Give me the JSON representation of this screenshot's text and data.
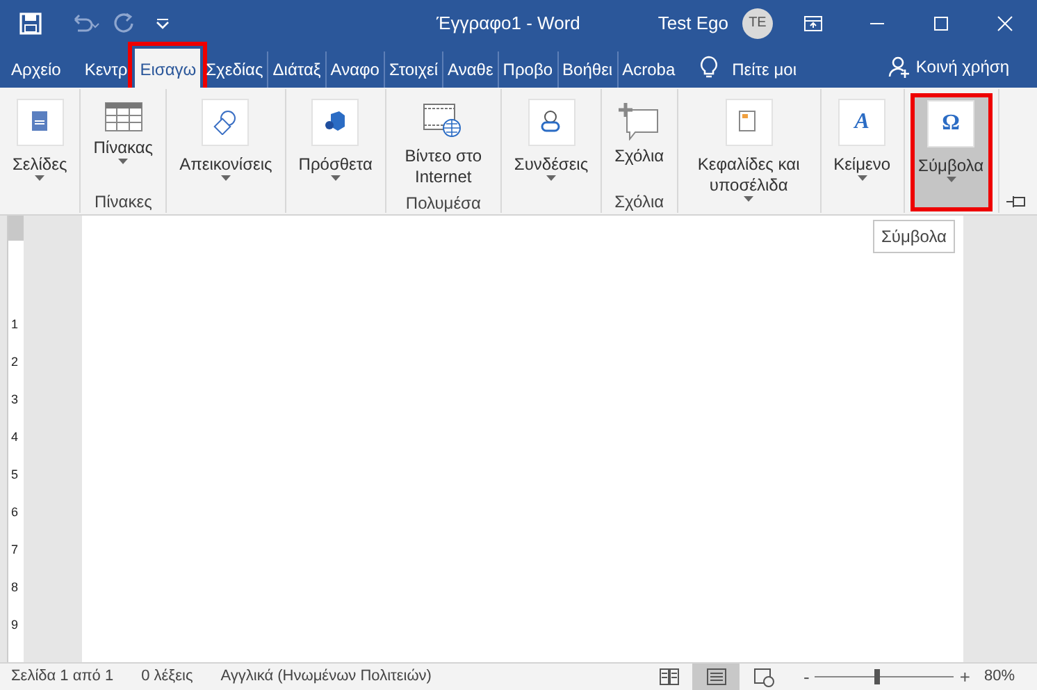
{
  "title_bar": {
    "title": "Έγγραφο1 - Word",
    "user": "Test Ego",
    "avatar_initials": "TE"
  },
  "tabs": [
    {
      "label": "Αρχείο",
      "selected": false,
      "annotated": false
    },
    {
      "label": "Κεντρ",
      "selected": false,
      "annotated": false
    },
    {
      "label": "Εισαγω",
      "selected": true,
      "annotated": true
    },
    {
      "label": "Σχεδίας",
      "selected": false,
      "annotated": false
    },
    {
      "label": "Διάταξ",
      "selected": false,
      "annotated": false
    },
    {
      "label": "Αναφο",
      "selected": false,
      "annotated": false
    },
    {
      "label": "Στοιχεί",
      "selected": false,
      "annotated": false
    },
    {
      "label": "Αναθε",
      "selected": false,
      "annotated": false
    },
    {
      "label": "Προβο",
      "selected": false,
      "annotated": false
    },
    {
      "label": "Βοήθει",
      "selected": false,
      "annotated": false
    },
    {
      "label": "Acroba",
      "selected": false,
      "annotated": false
    }
  ],
  "tell_me": "Πείτε μοι",
  "share": "Κοινή χρήση",
  "ribbon": {
    "groups": [
      {
        "buttons": [
          {
            "kind": "pages",
            "label": "Σελίδες",
            "dropdown": true,
            "pressed": false,
            "annotated": false
          }
        ]
      },
      {
        "label": "Πίνακες",
        "buttons": [
          {
            "kind": "table",
            "label": "Πίνακας",
            "dropdown": true,
            "pressed": false,
            "annotated": false
          }
        ]
      },
      {
        "buttons": [
          {
            "kind": "shapes",
            "label": "Απεικονίσεις",
            "dropdown": true,
            "pressed": false,
            "annotated": false
          }
        ]
      },
      {
        "buttons": [
          {
            "kind": "addins",
            "label": "Πρόσθετα",
            "dropdown": true,
            "pressed": false,
            "annotated": false
          }
        ]
      },
      {
        "label": "Πολυμέσα",
        "buttons": [
          {
            "kind": "video",
            "label": "Βίντεο στο Internet",
            "dropdown": false,
            "pressed": false,
            "annotated": false
          }
        ]
      },
      {
        "buttons": [
          {
            "kind": "links",
            "label": "Συνδέσεις",
            "dropdown": true,
            "pressed": false,
            "annotated": false
          }
        ]
      },
      {
        "label": "Σχόλια",
        "buttons": [
          {
            "kind": "comment",
            "label": "Σχόλια",
            "dropdown": false,
            "pressed": false,
            "annotated": false
          }
        ]
      },
      {
        "buttons": [
          {
            "kind": "header",
            "label": "Κεφαλίδες και υποσέλιδα",
            "dropdown": true,
            "pressed": false,
            "annotated": false
          }
        ]
      },
      {
        "buttons": [
          {
            "kind": "text",
            "glyph": "A",
            "label": "Κείμενο",
            "dropdown": true,
            "pressed": false,
            "annotated": false
          }
        ]
      },
      {
        "buttons": [
          {
            "kind": "symbols",
            "glyph": "Ω",
            "label": "Σύμβολα",
            "dropdown": true,
            "pressed": true,
            "annotated": true
          }
        ]
      }
    ]
  },
  "tooltip": "Σύμβολα",
  "ruler": [
    "1",
    "2",
    "3",
    "4",
    "5",
    "6",
    "7",
    "8",
    "9"
  ],
  "status_bar": {
    "page": "Σελίδα 1 από 1",
    "words": "0 λέξεις",
    "language": "Αγγλικά (Ηνωμένων Πολιτειών)",
    "views": [
      {
        "kind": "read",
        "selected": false
      },
      {
        "kind": "print",
        "selected": true
      },
      {
        "kind": "web",
        "selected": false
      }
    ],
    "zoom_minus": "-",
    "zoom_plus": "+",
    "zoom_slider": {
      "level": 0.45
    },
    "zoom": "80%"
  }
}
